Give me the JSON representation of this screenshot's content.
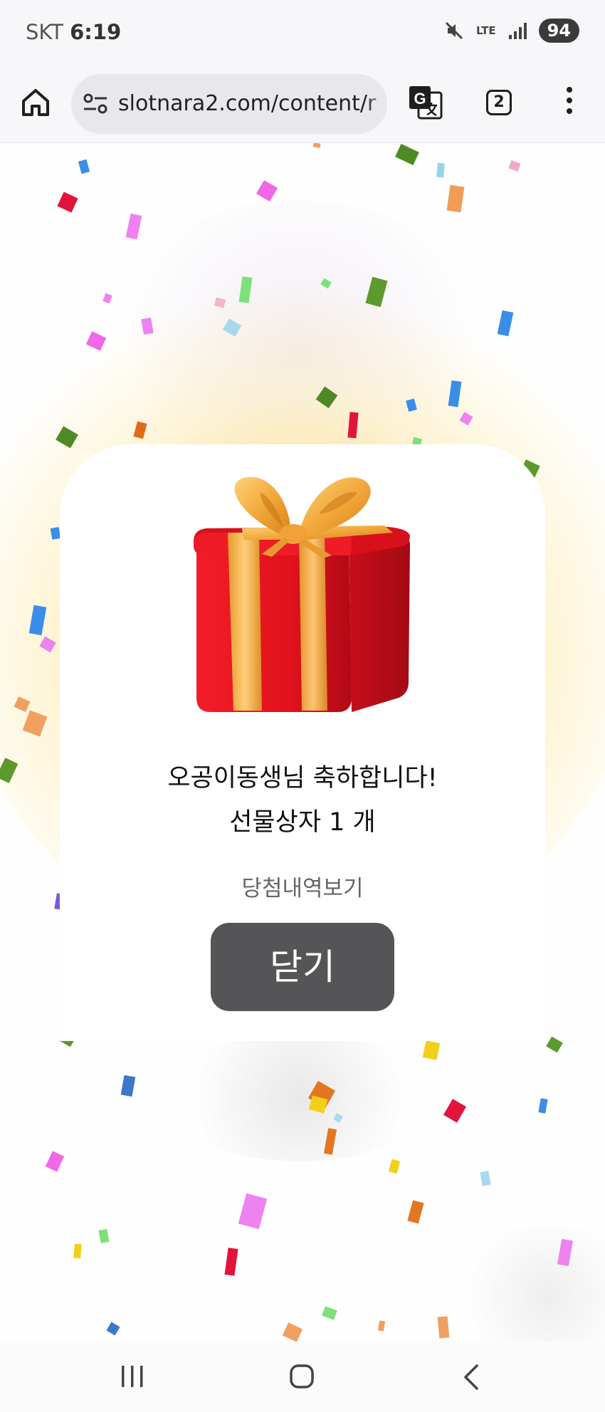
{
  "status_bar": {
    "carrier": "SKT",
    "time": "6:19",
    "network": "LTE",
    "battery": "94"
  },
  "browser": {
    "url": "slotnara2.com/content/r",
    "tab_count": "2"
  },
  "popup": {
    "message_line1": "오공이동생님 축하합니다!",
    "message_line2": "선물상자 1 개",
    "history_link": "당첨내역보기",
    "close_button": "닫기"
  },
  "colors": {
    "close_button_bg": "#555457",
    "gift_red": "#e3101e",
    "ribbon_gold": "#f2a93b"
  },
  "icons": {
    "browser": [
      "home-icon",
      "site-settings-icon",
      "translate-icon",
      "tab-switcher-icon",
      "more-menu-icon"
    ],
    "status": [
      "mute-icon",
      "signal-icon",
      "battery-icon"
    ],
    "navigation": [
      "recents-icon",
      "home-nav-icon",
      "back-icon"
    ]
  }
}
